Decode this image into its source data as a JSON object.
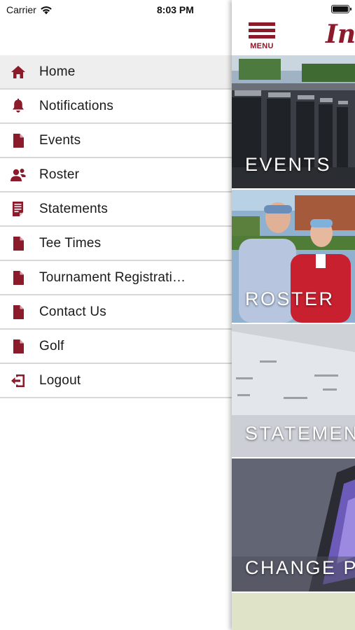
{
  "status_bar": {
    "carrier": "Carrier",
    "time": "8:03 PM"
  },
  "drawer": {
    "items": [
      {
        "label": "Home",
        "icon": "home-icon",
        "active": true
      },
      {
        "label": "Notifications",
        "icon": "bell-icon",
        "active": false
      },
      {
        "label": "Events",
        "icon": "document-icon",
        "active": false
      },
      {
        "label": "Roster",
        "icon": "users-icon",
        "active": false
      },
      {
        "label": "Statements",
        "icon": "statement-icon",
        "active": false
      },
      {
        "label": "Tee Times",
        "icon": "document-icon",
        "active": false
      },
      {
        "label": "Tournament Registrati…",
        "icon": "document-icon",
        "active": false
      },
      {
        "label": "Contact Us",
        "icon": "document-icon",
        "active": false
      },
      {
        "label": "Golf",
        "icon": "document-icon",
        "active": false
      },
      {
        "label": "Logout",
        "icon": "logout-icon",
        "active": false
      }
    ]
  },
  "header": {
    "menu_label": "MENU",
    "logo_text": "In"
  },
  "tiles": [
    {
      "label": "EVENTS"
    },
    {
      "label": "ROSTER"
    },
    {
      "label": "STATEMEN"
    },
    {
      "label": "CHANGE P"
    }
  ],
  "colors": {
    "accent": "#8b1a2b",
    "active_row": "#eeeeee",
    "divider": "#d8d8d8"
  }
}
